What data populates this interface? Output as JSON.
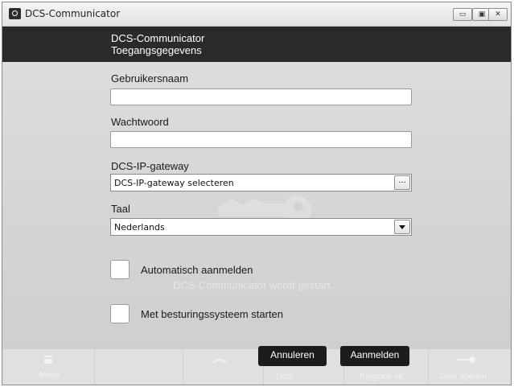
{
  "window": {
    "title": "DCS-Communicator",
    "controls": {
      "minimize": "▭",
      "maximize": "▣",
      "close": "✕"
    }
  },
  "header": {
    "line1": "DCS-Communicator",
    "line2": "Toegangsgegevens"
  },
  "form": {
    "username": {
      "label": "Gebruikersnaam",
      "value": ""
    },
    "password": {
      "label": "Wachtwoord",
      "value": ""
    },
    "gateway": {
      "label": "DCS-IP-gateway",
      "value": "DCS-IP-gateway selecteren",
      "browse": "..."
    },
    "language": {
      "label": "Taal",
      "value": "Nederlands"
    }
  },
  "options": {
    "auto_login": {
      "label": "Automatisch aanmelden",
      "checked": false
    },
    "status_text": "DCS-Communicator wordt gestart...",
    "start_with_os": {
      "label": "Met besturingssysteem starten",
      "checked": false
    }
  },
  "bottom_bar": {
    "menu": "Menu",
    "light": "Licht",
    "ringtone": "Ringtone uit",
    "door": "Deur openen"
  },
  "actions": {
    "cancel": "Annuleren",
    "login": "Aanmelden"
  },
  "icons": {
    "app": "app-eye-icon",
    "menu": "menu-icon",
    "phone": "phone-icon",
    "door": "key-icon",
    "watermark": "key-icon"
  },
  "colors": {
    "header_bg": "#2a2a2a",
    "content_bg": "#d6d6d6",
    "button_bg": "#1c1c1c"
  }
}
